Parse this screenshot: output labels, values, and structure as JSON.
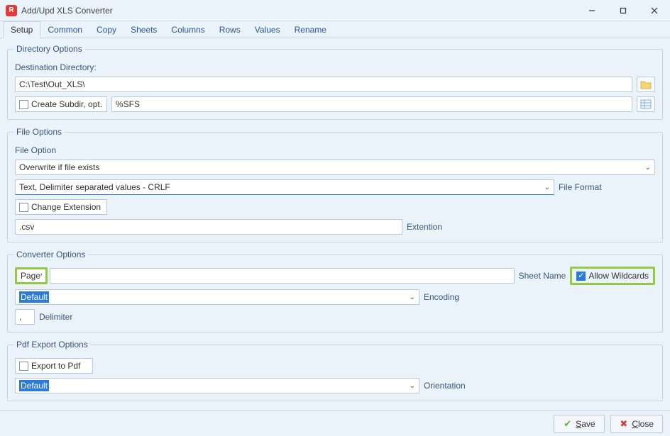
{
  "window": {
    "title": "Add/Upd XLS Converter",
    "app_icon_letter": "R"
  },
  "tabs": [
    "Setup",
    "Common",
    "Copy",
    "Sheets",
    "Columns",
    "Rows",
    "Values",
    "Rename"
  ],
  "active_tab": 0,
  "directory_options": {
    "legend": "Directory Options",
    "dest_label": "Destination Directory:",
    "dest_value": "C:\\Test\\Out_XLS\\",
    "create_subdir_label": "Create Subdir, opt.",
    "create_subdir_checked": false,
    "subdir_pattern": "%SFS"
  },
  "file_options": {
    "legend": "File Options",
    "file_option_label": "File Option",
    "file_option_value": "Overwrite if file exists",
    "file_format_label": "File Format",
    "file_format_value": "Text, Delimiter separated values - CRLF",
    "change_ext_label": "Change Extension",
    "change_ext_checked": false,
    "extension_value": ".csv",
    "extension_label": "Extention"
  },
  "converter_options": {
    "legend": "Converter Options",
    "sheet_name_value": "Page*",
    "sheet_name_label": "Sheet Name",
    "allow_wildcards_label": "Allow Wildcards",
    "allow_wildcards_checked": true,
    "encoding_value": "Default",
    "encoding_label": "Encoding",
    "delimiter_value": ",",
    "delimiter_label": "Delimiter"
  },
  "pdf_export": {
    "legend": "Pdf Export Options",
    "export_label": "Export to Pdf",
    "export_checked": false,
    "orientation_value": "Default",
    "orientation_label": "Orientation"
  },
  "buttons": {
    "save_letter": "S",
    "save_rest": "ave",
    "close_letter": "C",
    "close_rest": "lose"
  }
}
